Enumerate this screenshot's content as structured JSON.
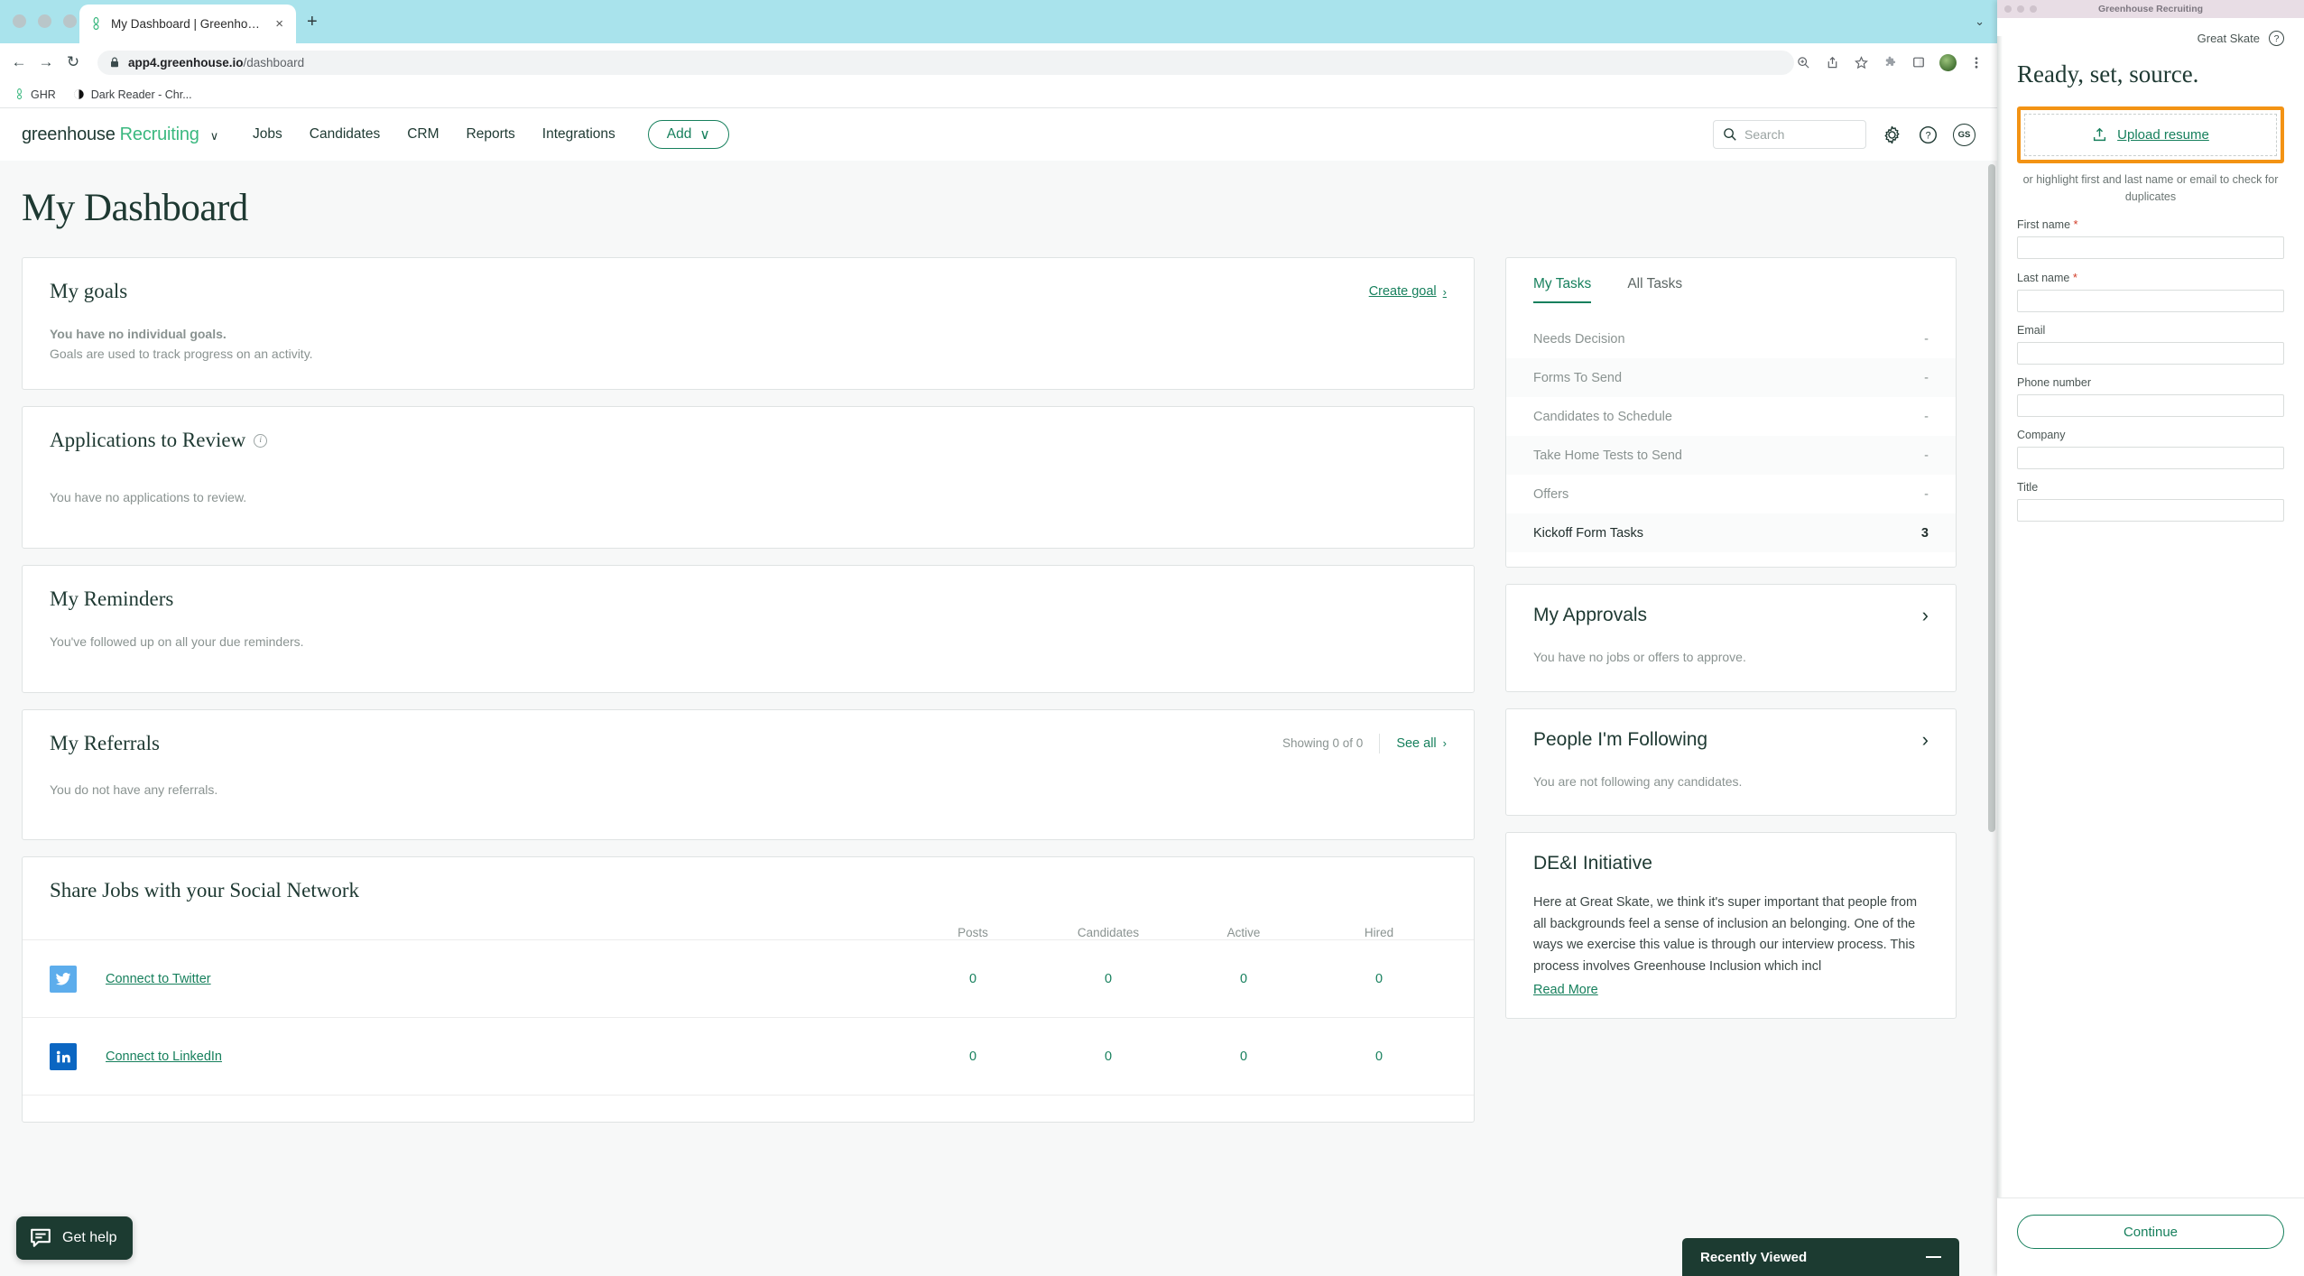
{
  "browser": {
    "tab": {
      "title": "My Dashboard | Greenhouse",
      "favicon": "greenhouse-icon",
      "close": "×"
    },
    "new_tab": "+",
    "tab_list_chevron": "⌄",
    "nav": {
      "back": "←",
      "forward": "→",
      "reload": "↻"
    },
    "url": {
      "lock": "🔒",
      "prefix": "app4.greenhouse.io",
      "path": "/dashboard"
    },
    "toolbar_icons": [
      "zoom-icon",
      "share-icon",
      "bookmark-star-icon",
      "extensions-puzzle-icon",
      "sidepanel-icon",
      "profile-avatar",
      "chrome-menu-icon"
    ],
    "bookmarks": [
      {
        "label": "GHR",
        "icon": "greenhouse-icon"
      },
      {
        "label": "Dark Reader - Chr...",
        "icon": "dark-reader-icon"
      }
    ]
  },
  "app": {
    "logo": {
      "part1": "greenhouse",
      "part2": "Recruiting",
      "chevron": "∨"
    },
    "nav_links": [
      "Jobs",
      "Candidates",
      "CRM",
      "Reports",
      "Integrations"
    ],
    "add_button": {
      "label": "Add",
      "chevron": "∨"
    },
    "search": {
      "placeholder": "Search",
      "value": ""
    },
    "gear_icon": "gear-icon",
    "help_icon": "help-icon",
    "avatar_initials": "GS",
    "page_title": "My Dashboard"
  },
  "left_column": {
    "goals": {
      "title": "My goals",
      "action": "Create goal",
      "action_arrow": "›",
      "empty_bold": "You have no individual goals.",
      "empty_sub": "Goals are used to track progress on an activity."
    },
    "applications": {
      "title": "Applications to Review",
      "info_icon": "info-icon",
      "empty": "You have no applications to review."
    },
    "reminders": {
      "title": "My Reminders",
      "empty": "You've followed up on all your due reminders."
    },
    "referrals": {
      "title": "My Referrals",
      "showing": "Showing 0 of 0",
      "see_all": "See all",
      "see_all_arrow": "›",
      "empty": "You do not have any referrals."
    },
    "social": {
      "title": "Share Jobs with your Social Network",
      "columns": [
        "Posts",
        "Candidates",
        "Active",
        "Hired"
      ],
      "rows": [
        {
          "icon": "twitter-icon",
          "label": "Connect to Twitter",
          "values": [
            "0",
            "0",
            "0",
            "0"
          ]
        },
        {
          "icon": "linkedin-icon",
          "label": "Connect to LinkedIn",
          "values": [
            "0",
            "0",
            "0",
            "0"
          ]
        }
      ]
    }
  },
  "right_column": {
    "tasks": {
      "tabs": [
        {
          "label": "My Tasks",
          "active": true
        },
        {
          "label": "All Tasks",
          "active": false
        }
      ],
      "rows": [
        {
          "label": "Needs Decision",
          "value": "-",
          "strong": false
        },
        {
          "label": "Forms To Send",
          "value": "-",
          "strong": false
        },
        {
          "label": "Candidates to Schedule",
          "value": "-",
          "strong": false
        },
        {
          "label": "Take Home Tests to Send",
          "value": "-",
          "strong": false
        },
        {
          "label": "Offers",
          "value": "-",
          "strong": false
        },
        {
          "label": "Kickoff Form Tasks",
          "value": "3",
          "strong": true
        }
      ]
    },
    "approvals": {
      "title": "My Approvals",
      "chevron": "›",
      "empty": "You have no jobs or offers to approve."
    },
    "following": {
      "title": "People I'm Following",
      "chevron": "›",
      "empty": "You are not following any candidates."
    },
    "dei": {
      "title": "DE&I Initiative",
      "body": "Here at Great Skate, we think it's super important that people from all backgrounds feel a sense of inclusion an belonging. One of the ways we exercise this value is through our interview process. This process involves Greenhouse Inclusion which incl",
      "read_more": "Read More"
    }
  },
  "widgets": {
    "get_help": {
      "label": "Get help",
      "icon": "chat-bubble-icon"
    },
    "recently_viewed": {
      "label": "Recently Viewed",
      "minimize": "—"
    }
  },
  "panel": {
    "window_title": "Greenhouse Recruiting",
    "org": "Great Skate",
    "help_icon": "question-circle-icon",
    "heading": "Ready, set, source.",
    "upload": {
      "label": "Upload resume",
      "icon": "upload-icon"
    },
    "upload_sub": "or highlight first and last name or email to check for duplicates",
    "fields": [
      {
        "label": "First name",
        "required": true,
        "value": ""
      },
      {
        "label": "Last name",
        "required": true,
        "value": ""
      },
      {
        "label": "Email",
        "required": false,
        "value": ""
      },
      {
        "label": "Phone number",
        "required": false,
        "value": ""
      },
      {
        "label": "Company",
        "required": false,
        "value": ""
      },
      {
        "label": "Title",
        "required": false,
        "value": ""
      }
    ],
    "continue_label": "Continue"
  },
  "colors": {
    "brand_green": "#17805d",
    "dark_green": "#1e3932",
    "accent_orange": "#f39314",
    "tab_strip": "#a9e3ec",
    "twitter_blue": "#5dadec",
    "linkedin_blue": "#0b66c2"
  }
}
